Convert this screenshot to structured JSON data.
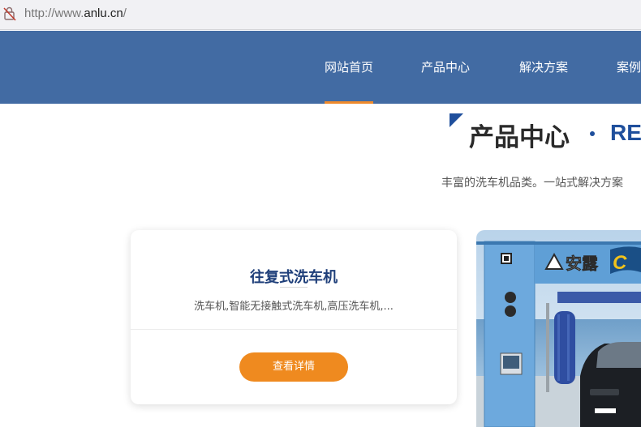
{
  "browser": {
    "url_prefix": "http://www.",
    "url_host": "anlu.cn",
    "url_suffix": "/"
  },
  "nav": {
    "items": [
      {
        "label": "网站首页",
        "active": true
      },
      {
        "label": "产品中心",
        "active": false
      },
      {
        "label": "解决方案",
        "active": false
      },
      {
        "label": "案例",
        "active": false
      }
    ]
  },
  "section": {
    "title_zh": "产品中心",
    "title_en": "REI",
    "subtitle": "丰富的洗车机品类。一站式解决方案"
  },
  "product_card": {
    "title": "往复式洗车机",
    "description": "洗车机,智能无接触式洗车机,高压洗车机,...",
    "button_label": "查看详情"
  },
  "product_image": {
    "brand_text": "安露"
  },
  "colors": {
    "nav_bg": "#426ba3",
    "accent_orange": "#ef8a1f",
    "title_blue": "#1f4f9c"
  }
}
